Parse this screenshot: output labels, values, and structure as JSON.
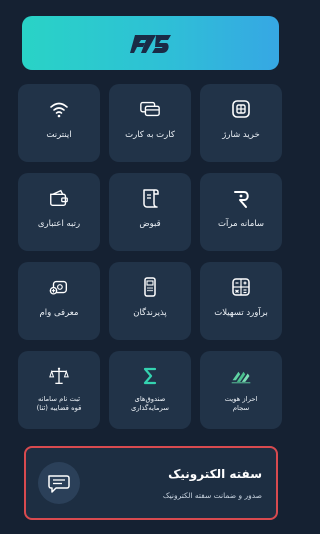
{
  "banner": {
    "logo": "app-logo"
  },
  "tiles": [
    {
      "label": "خرید شارژ",
      "icon": "sim-charge-icon"
    },
    {
      "label": "کارت به کارت",
      "icon": "cards-transfer-icon"
    },
    {
      "label": "اینترنت",
      "icon": "wifi-icon"
    },
    {
      "label": "سامانه مرآت",
      "icon": "merat-icon"
    },
    {
      "label": "قبوض",
      "icon": "bill-icon"
    },
    {
      "label": "رتبه اعتباری",
      "icon": "credit-score-icon"
    },
    {
      "label": "برآورد تسهیلات",
      "icon": "calculator-icon"
    },
    {
      "label": "پذیرندگان",
      "icon": "pos-terminal-icon"
    },
    {
      "label": "معرفی وام",
      "icon": "loan-icon"
    },
    {
      "label": "احراز هویت\nسجام",
      "icon": "sejam-icon"
    },
    {
      "label": "صندوق‌های\nسرمایه‌گذاری",
      "icon": "sigma-icon"
    },
    {
      "label": "ثبت نام سامانه\nقوه قضاییه (ثنا)",
      "icon": "justice-scale-icon"
    }
  ],
  "card": {
    "title": "سفته الکترونیک",
    "subtitle": "صدور و ضمانت سفته الکترونیک",
    "icon": "promissory-note-icon"
  },
  "colors": {
    "accent": "#2ec8cf",
    "highlight": "#d84a4f",
    "tile": "#213348"
  }
}
